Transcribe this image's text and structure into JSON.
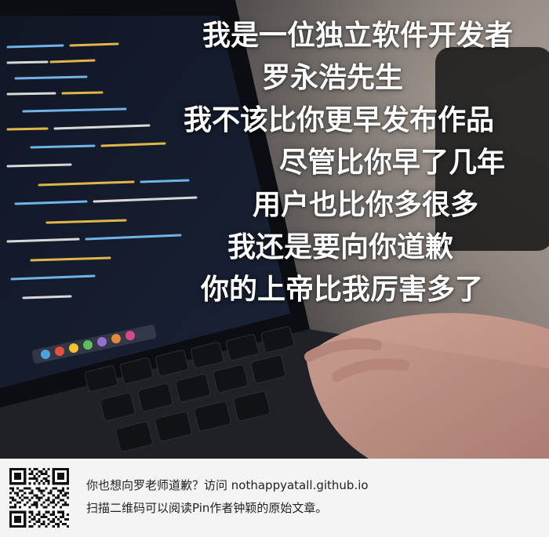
{
  "overlay": {
    "lines": [
      "我是一位独立软件开发者",
      "罗永浩先生",
      "我不该比你更早发布作品",
      "尽管比你早了几年",
      "用户也比你多很多",
      "我还是要向你道歉",
      "你的上帝比我厉害多了"
    ]
  },
  "footer": {
    "line1_prefix": "你也想向罗老师道歉？访问 ",
    "line1_link": "nothappyatall.github.io",
    "line2": "扫描二维码可以阅读Pin作者钟颖的原始文章。"
  },
  "colors": {
    "overlay_text": "#ffffff",
    "footer_bg": "#f4f4f4",
    "footer_text": "#222222",
    "code_keyword": "#e0b64a",
    "code_string": "#6fb3e8",
    "code_plain": "#d8d8d8"
  },
  "icons": {
    "qr": "qr-code-icon"
  }
}
